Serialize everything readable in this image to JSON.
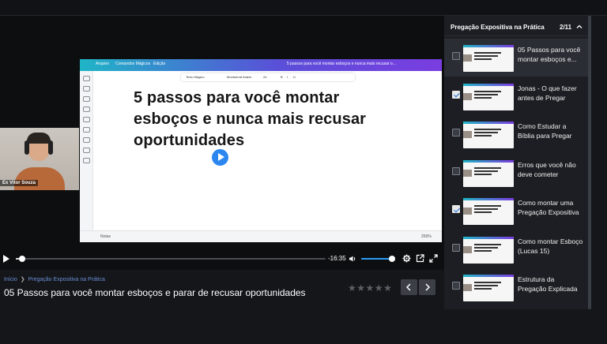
{
  "player": {
    "slide_text": "5 passos para você montar esboços e nunca mais recusar oportunidades",
    "editor": {
      "top_left_items": [
        "Arquivo",
        "Comandos Mágicos",
        "Edição"
      ],
      "top_right_text": "5 passos para você montar esboços e nunca mais recusar o...",
      "toolbar_items": [
        "Texto Mágico",
        "Montserrat Arabic",
        "24",
        "B",
        "I",
        "U"
      ],
      "bottom_left": "Notas",
      "bottom_right": "269%"
    },
    "webcam_label": "Ex Vitor Souza",
    "time_remaining": "-16:35",
    "progress": 0.02,
    "volume": 0.9
  },
  "below": {
    "breadcrumb": [
      "Início",
      "Pregação Expositiva na Prática"
    ],
    "lesson_title": "05 Passos para você montar esboços e parar de recusar oportunidades",
    "rating": 0,
    "rating_max": 5
  },
  "sidebar": {
    "title": "Pregação Expositiva na Prática",
    "count": "2/11",
    "items": [
      {
        "label": "05 Passos para você montar esboços e...",
        "checked": false,
        "active": true
      },
      {
        "label": "Jonas - O que fazer antes de Pregar",
        "checked": true,
        "active": false
      },
      {
        "label": "Como Estudar a Bíblia para Pregar",
        "checked": false,
        "active": false
      },
      {
        "label": "Erros que você não deve cometer",
        "checked": false,
        "active": false
      },
      {
        "label": "Como montar uma Pregação Expositiva",
        "checked": true,
        "active": false
      },
      {
        "label": "Como montar Esboço (Lucas 15)",
        "checked": false,
        "active": false
      },
      {
        "label": "Estrutura da Pregação Explicada",
        "checked": false,
        "active": false
      }
    ]
  },
  "colors": {
    "accent": "#2b86f0",
    "volume": "#2b9bf4",
    "breadcrumb": "#6b8fd6"
  }
}
